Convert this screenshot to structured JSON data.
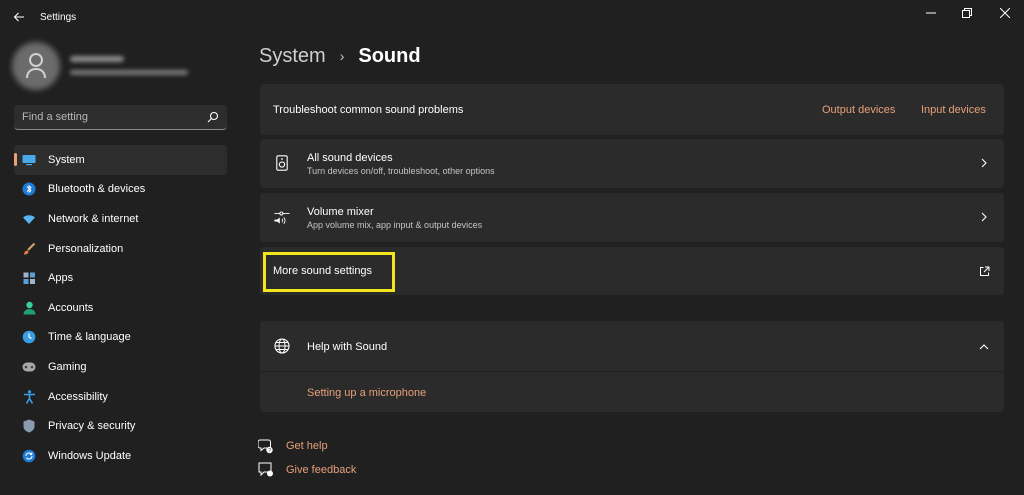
{
  "window": {
    "app_title": "Settings",
    "back_icon": "back-arrow-icon",
    "controls": [
      "minimize-icon",
      "restore-icon",
      "close-icon"
    ]
  },
  "search": {
    "placeholder": "Find a setting"
  },
  "sidebar": {
    "items": [
      {
        "label": "System",
        "icon": "system-icon",
        "active": true
      },
      {
        "label": "Bluetooth & devices",
        "icon": "bluetooth-icon"
      },
      {
        "label": "Network & internet",
        "icon": "wifi-icon"
      },
      {
        "label": "Personalization",
        "icon": "brush-icon"
      },
      {
        "label": "Apps",
        "icon": "apps-icon"
      },
      {
        "label": "Accounts",
        "icon": "accounts-icon"
      },
      {
        "label": "Time & language",
        "icon": "time-icon"
      },
      {
        "label": "Gaming",
        "icon": "gaming-icon"
      },
      {
        "label": "Accessibility",
        "icon": "accessibility-icon"
      },
      {
        "label": "Privacy & security",
        "icon": "shield-icon"
      },
      {
        "label": "Windows Update",
        "icon": "update-icon"
      }
    ]
  },
  "breadcrumb": {
    "parent": "System",
    "separator": "›",
    "current": "Sound"
  },
  "troubleshoot": {
    "label": "Troubleshoot common sound problems",
    "output_link": "Output devices",
    "input_link": "Input devices"
  },
  "all_devices": {
    "title": "All sound devices",
    "subtitle": "Turn devices on/off, troubleshoot, other options"
  },
  "volume_mixer": {
    "title": "Volume mixer",
    "subtitle": "App volume mix, app input & output devices"
  },
  "more_sound": {
    "title": "More sound settings"
  },
  "help": {
    "title": "Help with Sound",
    "link": "Setting up a microphone"
  },
  "footer": {
    "get_help": "Get help",
    "give_feedback": "Give feedback"
  },
  "colors": {
    "background": "#202020",
    "card": "#2b2b2b",
    "accent": "#e8a07a",
    "highlight": "#f3e51c"
  }
}
